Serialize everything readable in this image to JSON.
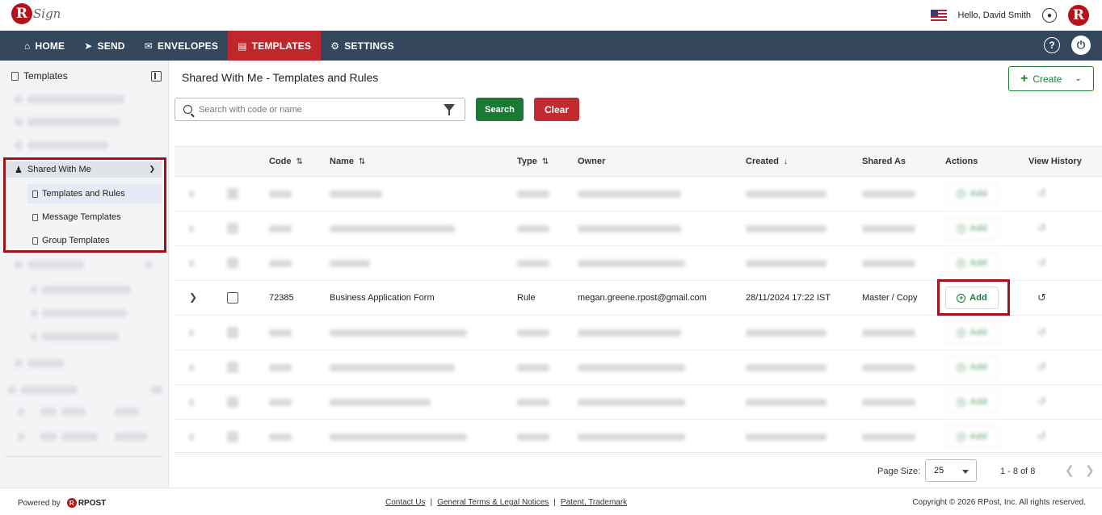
{
  "header": {
    "logo_letter": "R",
    "logo_text": "Sign",
    "greeting": "Hello, David Smith",
    "brand_letter": "R"
  },
  "nav": {
    "items": [
      {
        "label": "HOME",
        "icon": "home-icon"
      },
      {
        "label": "SEND",
        "icon": "send-icon"
      },
      {
        "label": "ENVELOPES",
        "icon": "envelope-icon"
      },
      {
        "label": "TEMPLATES",
        "icon": "document-icon",
        "active": true
      },
      {
        "label": "SETTINGS",
        "icon": "gear-icon"
      }
    ]
  },
  "sidebar": {
    "title": "Templates",
    "shared_section": "Shared With Me",
    "sub_items": [
      {
        "label": "Templates and Rules",
        "active": true
      },
      {
        "label": "Message Templates"
      },
      {
        "label": "Group Templates"
      }
    ]
  },
  "main": {
    "title": "Shared With Me - Templates and Rules",
    "create_label": "Create",
    "search_placeholder": "Search with code or name",
    "search_label": "Search",
    "clear_label": "Clear"
  },
  "table": {
    "headers": {
      "code": "Code",
      "name": "Name",
      "type": "Type",
      "owner": "Owner",
      "created": "Created",
      "shared_as": "Shared As",
      "actions": "Actions",
      "view_history": "View History"
    },
    "action_label": "Add",
    "highlighted_row": {
      "code": "72385",
      "name": "Business Application Form",
      "type": "Rule",
      "owner": "megan.greene.rpost@gmail.com",
      "created": "28/11/2024 17:22 IST",
      "shared_as": "Master / Copy"
    }
  },
  "pagination": {
    "page_size_label": "Page Size:",
    "page_size": "25",
    "range": "1 - 8 of 8"
  },
  "footer": {
    "powered_by": "Powered by",
    "rpost": "RPOST",
    "links": [
      "Contact Us",
      "General Terms & Legal Notices",
      "Patent, Trademark"
    ],
    "copyright": "Copyright © 2026 RPost, Inc. All rights reserved."
  },
  "colors": {
    "nav_bg": "#34475d",
    "active_red": "#c0272d",
    "highlight_border": "#a11219",
    "green": "#1a7a35"
  }
}
